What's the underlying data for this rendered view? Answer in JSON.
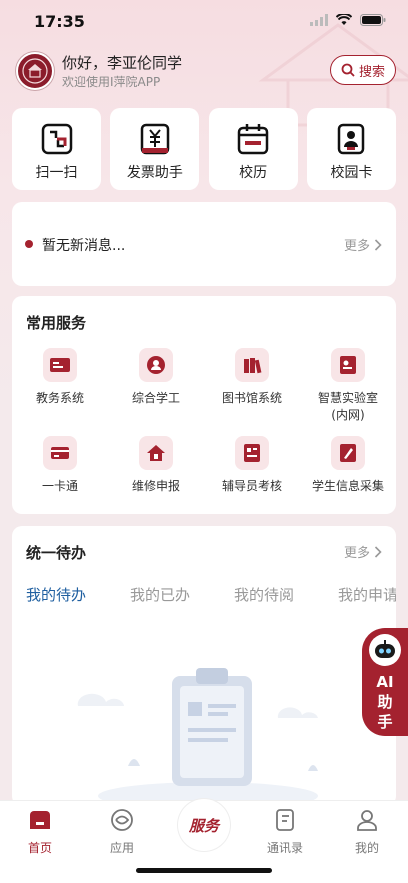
{
  "status_bar": {
    "time": "17:35"
  },
  "header": {
    "greeting": "你好，李亚伦同学",
    "subtitle": "欢迎使用I萍院APP",
    "search_label": "搜索"
  },
  "quick_actions": [
    {
      "label": "扫一扫",
      "icon": "scan-icon"
    },
    {
      "label": "发票助手",
      "icon": "invoice-icon"
    },
    {
      "label": "校历",
      "icon": "calendar-icon"
    },
    {
      "label": "校园卡",
      "icon": "campus-card-icon"
    }
  ],
  "messages": {
    "text": "暂无新消息...",
    "more_label": "更多"
  },
  "services": {
    "title": "常用服务",
    "items": [
      {
        "label": "教务系统",
        "icon": "academic-system-icon"
      },
      {
        "label": "综合学工",
        "icon": "student-affairs-icon"
      },
      {
        "label": "图书馆系统",
        "icon": "library-icon"
      },
      {
        "label": "智慧实验室\n(内网)",
        "icon": "lab-icon"
      },
      {
        "label": "一卡通",
        "icon": "card-icon"
      },
      {
        "label": "维修申报",
        "icon": "repair-icon"
      },
      {
        "label": "辅导员考核",
        "icon": "counselor-icon"
      },
      {
        "label": "学生信息采集",
        "icon": "student-info-icon"
      }
    ]
  },
  "todo": {
    "title": "统一待办",
    "more_label": "更多",
    "tabs": [
      "我的待办",
      "我的已办",
      "我的待阅",
      "我的申请"
    ],
    "active_tab": 0
  },
  "ai_assistant": {
    "line1": "AI",
    "line2": "助",
    "line3": "手"
  },
  "bottom_nav": {
    "items": [
      {
        "label": "首页",
        "icon": "home-icon",
        "active": true
      },
      {
        "label": "应用",
        "icon": "apps-icon",
        "active": false
      },
      {
        "label": "服务",
        "icon": "service-icon",
        "active": false
      },
      {
        "label": "通讯录",
        "icon": "contacts-icon",
        "active": false
      },
      {
        "label": "我的",
        "icon": "profile-icon",
        "active": false
      }
    ]
  },
  "colors": {
    "accent": "#a4222f",
    "tab_active": "#1f5fa0",
    "background": "#f4eaec"
  }
}
